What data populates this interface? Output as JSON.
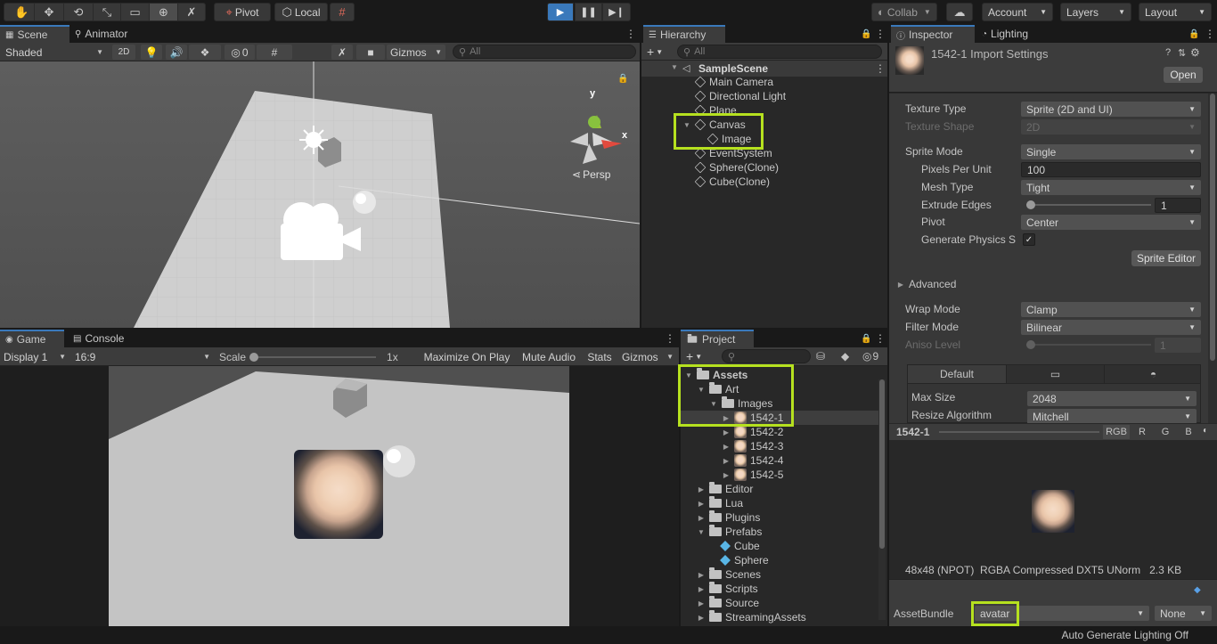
{
  "toolbar": {
    "pivot_label": "Pivot",
    "local_label": "Local",
    "collab_label": "Collab",
    "account_label": "Account",
    "layers_label": "Layers",
    "layout_label": "Layout"
  },
  "scene_panel": {
    "tabs": [
      "Scene",
      "Animator"
    ],
    "shading_mode": "Shaded",
    "mode_2d": "2D",
    "hidden_count": "0",
    "gizmos_label": "Gizmos",
    "search_placeholder": "All",
    "persp_label": "Persp",
    "gizmo_axes": {
      "y": "y",
      "x": "x"
    }
  },
  "hierarchy": {
    "tab": "Hierarchy",
    "search_placeholder": "All",
    "scene_name": "SampleScene",
    "items": [
      {
        "label": "Main Camera",
        "indent": 1
      },
      {
        "label": "Directional Light",
        "indent": 1
      },
      {
        "label": "Plane",
        "indent": 1
      },
      {
        "label": "Canvas",
        "indent": 1,
        "expanded": true
      },
      {
        "label": "Image",
        "indent": 2
      },
      {
        "label": "EventSystem",
        "indent": 1
      },
      {
        "label": "Sphere(Clone)",
        "indent": 1
      },
      {
        "label": "Cube(Clone)",
        "indent": 1
      }
    ]
  },
  "game_panel": {
    "tabs": [
      "Game",
      "Console"
    ],
    "display": "Display 1",
    "aspect": "16:9",
    "scale_label": "Scale",
    "scale_value": "1x",
    "maximize_on_play": "Maximize On Play",
    "mute_audio": "Mute Audio",
    "stats": "Stats",
    "gizmos": "Gizmos"
  },
  "project": {
    "tab": "Project",
    "hidden_count": "9",
    "tree": [
      {
        "label": "Assets",
        "indent": 0,
        "type": "folder",
        "expanded": true,
        "bold": true
      },
      {
        "label": "Art",
        "indent": 1,
        "type": "folder",
        "expanded": true
      },
      {
        "label": "Images",
        "indent": 2,
        "type": "folder",
        "expanded": true
      },
      {
        "label": "1542-1",
        "indent": 3,
        "type": "sprite",
        "selected": true
      },
      {
        "label": "1542-2",
        "indent": 3,
        "type": "sprite"
      },
      {
        "label": "1542-3",
        "indent": 3,
        "type": "sprite"
      },
      {
        "label": "1542-4",
        "indent": 3,
        "type": "sprite"
      },
      {
        "label": "1542-5",
        "indent": 3,
        "type": "sprite"
      },
      {
        "label": "Editor",
        "indent": 1,
        "type": "folder"
      },
      {
        "label": "Lua",
        "indent": 1,
        "type": "folder"
      },
      {
        "label": "Plugins",
        "indent": 1,
        "type": "folder"
      },
      {
        "label": "Prefabs",
        "indent": 1,
        "type": "folder",
        "expanded": true
      },
      {
        "label": "Cube",
        "indent": 2,
        "type": "prefab"
      },
      {
        "label": "Sphere",
        "indent": 2,
        "type": "prefab"
      },
      {
        "label": "Scenes",
        "indent": 1,
        "type": "folder"
      },
      {
        "label": "Scripts",
        "indent": 1,
        "type": "folder"
      },
      {
        "label": "Source",
        "indent": 1,
        "type": "folder"
      },
      {
        "label": "StreamingAssets",
        "indent": 1,
        "type": "folder"
      }
    ]
  },
  "inspector": {
    "tabs": [
      "Inspector",
      "Lighting"
    ],
    "title": "1542-1 Import Settings",
    "open_button": "Open",
    "rows": {
      "texture_type": {
        "label": "Texture Type",
        "value": "Sprite (2D and UI)"
      },
      "texture_shape": {
        "label": "Texture Shape",
        "value": "2D"
      },
      "sprite_mode": {
        "label": "Sprite Mode",
        "value": "Single"
      },
      "pixels_per_unit": {
        "label": "Pixels Per Unit",
        "value": "100"
      },
      "mesh_type": {
        "label": "Mesh Type",
        "value": "Tight"
      },
      "extrude_edges": {
        "label": "Extrude Edges",
        "value": "1"
      },
      "pivot": {
        "label": "Pivot",
        "value": "Center"
      },
      "generate_physics": {
        "label": "Generate Physics S",
        "value": "✓"
      },
      "advanced": {
        "label": "Advanced"
      },
      "wrap_mode": {
        "label": "Wrap Mode",
        "value": "Clamp"
      },
      "filter_mode": {
        "label": "Filter Mode",
        "value": "Bilinear"
      },
      "aniso_level": {
        "label": "Aniso Level",
        "value": "1"
      }
    },
    "sprite_editor_button": "Sprite Editor",
    "platform_tab_default": "Default",
    "max_size": {
      "label": "Max Size",
      "value": "2048"
    },
    "resize_algorithm": {
      "label": "Resize Algorithm",
      "value": "Mitchell"
    },
    "preview": {
      "name": "1542-1",
      "channels": [
        "RGB",
        "R",
        "G",
        "B"
      ],
      "info": "48x48 (NPOT)  RGBA Compressed DXT5 UNorm   2.3 KB"
    },
    "asset_bundle": {
      "label": "AssetBundle",
      "value": "avatar",
      "variant": "None"
    }
  },
  "status_bar": {
    "text": "Auto Generate Lighting Off"
  }
}
